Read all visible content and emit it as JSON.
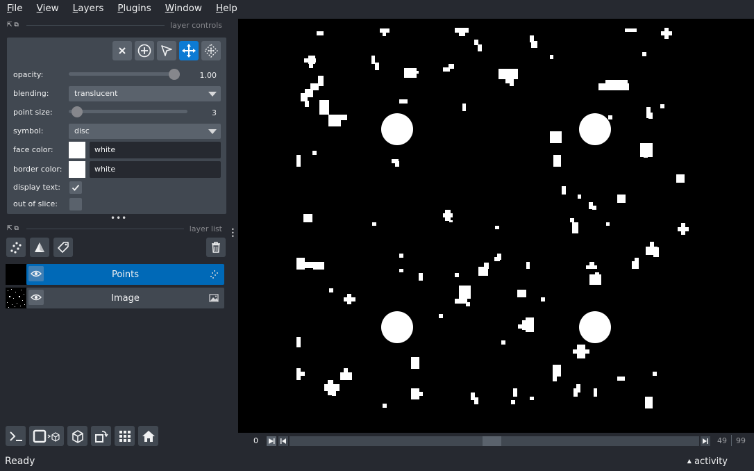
{
  "menubar": {
    "items": [
      {
        "label": "File",
        "mnemonic": "F",
        "rest": "ile"
      },
      {
        "label": "View",
        "mnemonic": "V",
        "rest": "iew"
      },
      {
        "label": "Layers",
        "mnemonic": "L",
        "rest": "ayers"
      },
      {
        "label": "Plugins",
        "mnemonic": "P",
        "rest": "lugins"
      },
      {
        "label": "Window",
        "mnemonic": "W",
        "rest": "indow"
      },
      {
        "label": "Help",
        "mnemonic": "H",
        "rest": "elp"
      }
    ]
  },
  "layer_controls": {
    "title": "layer controls",
    "opacity_label": "opacity:",
    "opacity_value": "1.00",
    "opacity_fraction": 1.0,
    "blending_label": "blending:",
    "blending_value": "translucent",
    "point_size_label": "point size:",
    "point_size_value": "3",
    "symbol_label": "symbol:",
    "symbol_value": "disc",
    "face_color_label": "face color:",
    "face_color_value": "white",
    "border_color_label": "border color:",
    "border_color_value": "white",
    "display_text_label": "display text:",
    "display_text_checked": true,
    "out_of_slice_label": "out of slice:",
    "out_of_slice_checked": false
  },
  "layer_list": {
    "title": "layer list",
    "layers": [
      {
        "name": "Points",
        "selected": true,
        "type_icon": "points-icon"
      },
      {
        "name": "Image",
        "selected": false,
        "type_icon": "image-icon"
      }
    ]
  },
  "dims": {
    "start": "0",
    "current": "49",
    "max": "99"
  },
  "status": {
    "text": "Ready",
    "activity": "activity"
  },
  "colors": {
    "background": "#262930",
    "panel": "#414851",
    "button": "#5a626c",
    "accent": "#0d7bd4",
    "selected_layer": "#0069b7"
  }
}
